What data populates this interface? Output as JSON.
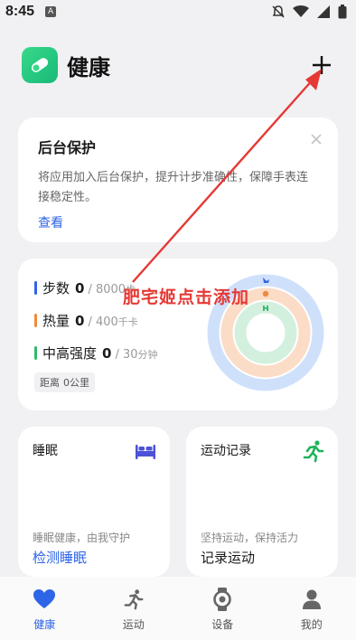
{
  "status_bar": {
    "time": "8:45",
    "notification_icon": "A",
    "icons": [
      "mute-icon",
      "wifi-icon",
      "signal-icon",
      "battery-icon"
    ]
  },
  "header": {
    "title": "健康",
    "logo_icon": "health-app-logo",
    "add_icon": "plus-icon"
  },
  "protect_card": {
    "title": "后台保护",
    "description": "将应用加入后台保护，提升计步准确性，保障手表连接稳定性。",
    "link": "查看",
    "close_icon": "close-icon"
  },
  "stats_card": {
    "steps": {
      "label": "步数",
      "value": "0",
      "target": "/ 8000",
      "unit": "步",
      "color": "#2e64e8",
      "progress": 0
    },
    "calories": {
      "label": "热量",
      "value": "0",
      "target": "/ 400",
      "unit": "千卡",
      "color": "#f08a3c",
      "progress": 0
    },
    "intensity": {
      "label": "中高强度",
      "value": "0",
      "target": "/ 30",
      "unit": "分钟",
      "color": "#33b86b",
      "progress": 0
    },
    "distance": {
      "label": "距离",
      "value": "0公里"
    }
  },
  "sleep_card": {
    "title": "睡眠",
    "subtitle": "睡眠健康，由我守护",
    "action": "检测睡眠",
    "icon": "bed-icon"
  },
  "sport_card": {
    "title": "运动记录",
    "subtitle": "坚持运动，保持活力",
    "action": "记录运动",
    "icon": "running-icon"
  },
  "bottom_nav": [
    {
      "label": "健康",
      "icon": "heart-icon",
      "active": true
    },
    {
      "label": "运动",
      "icon": "running-icon",
      "active": false
    },
    {
      "label": "设备",
      "icon": "watch-icon",
      "active": false
    },
    {
      "label": "我的",
      "icon": "profile-icon",
      "active": false
    }
  ],
  "annotation": {
    "text": "肥宅姬点击添加",
    "color": "#e53935"
  }
}
